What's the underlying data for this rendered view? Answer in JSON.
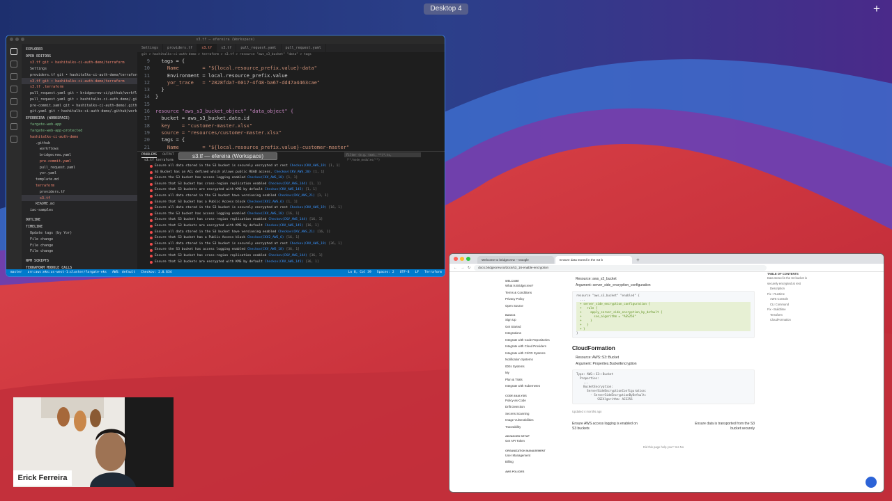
{
  "desktop": {
    "label": "Desktop 4"
  },
  "vscode": {
    "title": "s3.tf — efereira (Workspace)",
    "tabs": [
      "Settings",
      "providers.tf",
      "s3.tf",
      "s3.tf",
      "pull_request.yaml",
      "pull_request.yaml"
    ],
    "breadcrumb": "git > hashitalks-ci-auth-demo > terraform > s3.tf > resource \"aws_s3_bucket\" \"data\" > tags",
    "sidebar": {
      "header": "EXPLORER",
      "open_editors": "OPEN EDITORS",
      "workspace": "EFERREIRA (WORKSPACE)",
      "items": [
        "s3.tf git • hashitalks-ci-auth-demo/terraform",
        "Settings",
        "providers.tf git • hashitalks-ci-auth-demo/terraform",
        "s3.tf git • hashitalks-ci-auth-demo/terraform",
        "s3.tf .terraform",
        "pull_request.yaml git • bridgecrew-ci/github/workflows",
        "pull_request.yaml git • hashitalks-ci-auth-demo/.github",
        "pre-commit.yaml git • hashitalks-ci-auth-demo/.github",
        "git.yaml git • hashitalks-ci-auth-demo/.github/workflows",
        "fargate-web-app",
        "fargate-web-app-protected",
        "hashitalks-ci-auth-demo",
        ".github",
        "workflows",
        "bridgecrew.yaml",
        "pre-commit.yaml",
        "pull_request.yaml",
        "yor.yaml",
        "template.md",
        "terraform",
        "providers.tf",
        "s3.tf",
        "README.md",
        "iac-samples"
      ],
      "outline": "OUTLINE",
      "timeline": "TIMELINE",
      "timeline_items": [
        "Update tags (by Yor)",
        "File change",
        "File change",
        "File change"
      ],
      "npm_scripts": "NPM SCRIPTS",
      "terraform_calls": "TERRAFORM MODULE CALLS"
    },
    "code_lines": [
      {
        "n": "9",
        "t": "  tags = {"
      },
      {
        "n": "10",
        "t": "    Name        = \"${local.resource_prefix.value}-data\""
      },
      {
        "n": "11",
        "t": "    Environment = local.resource_prefix.value"
      },
      {
        "n": "12",
        "t": "    yor_trace   = \"2828fda7-6017-4f48-ba67-dd47a4463cae\""
      },
      {
        "n": "13",
        "t": "  }"
      },
      {
        "n": "14",
        "t": "}"
      },
      {
        "n": "15",
        "t": ""
      },
      {
        "n": "16",
        "t": "resource \"aws_s3_bucket_object\" \"data_object\" {"
      },
      {
        "n": "17",
        "t": "  bucket = aws_s3_bucket.data.id"
      },
      {
        "n": "18",
        "t": "  key    = \"customer-master.xlsx\""
      },
      {
        "n": "19",
        "t": "  source = \"resources/customer-master.xlsx\""
      },
      {
        "n": "20",
        "t": "  tags = {"
      },
      {
        "n": "21",
        "t": "    Name        = \"${local.resource_prefix.value}-customer-master\""
      }
    ],
    "panel": {
      "tabs": [
        "PROBLEMS",
        "OUTPUT",
        "TERMINAL",
        "DEBUG CONSOLE"
      ],
      "filter_placeholder": "Filter (e.g. text, **/*.ts, !**/node_modules/**)",
      "file_header": "s3.tf terraform",
      "problems": [
        {
          "msg": "Ensure all data stored in the S3 bucket is securely encrypted at rest",
          "src": "Checkov(CKV_AWS_19)",
          "pos": "[1, 1]"
        },
        {
          "msg": "S3 Bucket has an ACL defined which allows public READ access.",
          "src": "Checkov(CKV_AWS_20)",
          "pos": "[1, 1]"
        },
        {
          "msg": "Ensure the S3 bucket has access logging enabled",
          "src": "Checkov(CKV_AWS_18)",
          "pos": "[1, 1]"
        },
        {
          "msg": "Ensure that S3 bucket has cross-region replication enabled",
          "src": "Checkov(CKV_AWS_144)",
          "pos": "[1, 1]"
        },
        {
          "msg": "Ensure that S3 buckets are encrypted with KMS by default",
          "src": "Checkov(CKV_AWS_145)",
          "pos": "[1, 1]"
        },
        {
          "msg": "Ensure all data stored in the S3 bucket have versioning enabled",
          "src": "Checkov(CKV_AWS_21)",
          "pos": "[1, 1]"
        },
        {
          "msg": "Ensure that S3 bucket has a Public Access block",
          "src": "Checkov(CKV2_AWS_6)",
          "pos": "[1, 1]"
        },
        {
          "msg": "Ensure all data stored in the S3 bucket is securely encrypted at rest",
          "src": "Checkov(CKV_AWS_19)",
          "pos": "[16, 1]"
        },
        {
          "msg": "Ensure the S3 bucket has access logging enabled",
          "src": "Checkov(CKV_AWS_18)",
          "pos": "[16, 1]"
        },
        {
          "msg": "Ensure that S3 bucket has cross-region replication enabled",
          "src": "Checkov(CKV_AWS_144)",
          "pos": "[16, 1]"
        },
        {
          "msg": "Ensure that S3 buckets are encrypted with KMS by default",
          "src": "Checkov(CKV_AWS_145)",
          "pos": "[16, 1]"
        },
        {
          "msg": "Ensure all data stored in the S3 bucket have versioning enabled",
          "src": "Checkov(CKV_AWS_21)",
          "pos": "[16, 1]"
        },
        {
          "msg": "Ensure that S3 bucket has a Public Access block",
          "src": "Checkov(CKV2_AWS_6)",
          "pos": "[16, 1]"
        },
        {
          "msg": "Ensure all data stored in the S3 bucket is securely encrypted at rest",
          "src": "Checkov(CKV_AWS_19)",
          "pos": "[36, 1]"
        },
        {
          "msg": "Ensure the S3 bucket has access logging enabled",
          "src": "Checkov(CKV_AWS_18)",
          "pos": "[36, 1]"
        },
        {
          "msg": "Ensure that S3 bucket has cross-region replication enabled",
          "src": "Checkov(CKV_AWS_144)",
          "pos": "[36, 1]"
        },
        {
          "msg": "Ensure that S3 buckets are encrypted with KMS by default",
          "src": "Checkov(CKV_AWS_145)",
          "pos": "[36, 1]"
        }
      ]
    },
    "status": {
      "left": [
        "master",
        "arn:aws:eks:us-west-1:cluster/fargate-eks",
        "AWS: default",
        "Checkov: 2.0.634"
      ],
      "right": [
        "Ln 8, Col 39",
        "Spaces: 2",
        "UTF-8",
        "LF",
        "Terraform"
      ]
    }
  },
  "browser": {
    "tabs": [
      "Welcome to bridgecrew – Google",
      "Ensure data stored in the S3 b"
    ],
    "url": "docs.bridgecrew.io/docs/s3_16-enable-encryption",
    "nav": {
      "groups": [
        {
          "title": "WELCOME",
          "items": [
            "What is Bridgecrew?",
            "Terms & Conditions",
            "Privacy Policy",
            "Open Source"
          ]
        },
        {
          "title": "BASICS",
          "items": [
            "Sign Up",
            "Get Started",
            "Integrations",
            "Integrate with Code Repositories",
            "Integrate with Cloud Providers",
            "Integrate with CI/CD Systems",
            "Notification Systems",
            "IDEs Systems",
            "My",
            "Plan & Trials",
            "Integrate with Kubernetes"
          ]
        },
        {
          "title": "CODE ANALYSIS",
          "items": [
            "Policy-as-Code",
            "Drift Detection",
            "Secrets Scanning",
            "Image Vulnerabilities",
            "Traceability"
          ]
        },
        {
          "title": "ADVANCED SETUP",
          "items": [
            "Get API Token"
          ]
        },
        {
          "title": "ORGANIZATION MANAGEMENT",
          "items": [
            "User Management",
            "Billing"
          ]
        },
        {
          "title": "AWS POLICIES",
          "items": []
        }
      ]
    },
    "main": {
      "tf_resource": "Resource: aws_s3_bucket",
      "tf_argument": "Argument: server_side_encryption_configuration",
      "tf_code": [
        "resource \"aws_s3_bucket\" \"enabled\" {",
        "  ...",
        "  + server_side_encryption_configuration {",
        "  +   rule {",
        "  +     apply_server_side_encryption_by_default {",
        "  +       sse_algorithm = \"AES256\"",
        "  +     }",
        "  +   }",
        "  + }",
        "}"
      ],
      "cf_heading": "CloudFormation",
      "cf_resource": "Resource: AWS::S3::Bucket",
      "cf_argument": "Argument: Properties.BucketEncryption",
      "cf_code": [
        "Type: AWS::S3::Bucket",
        "  Properties:",
        "    ...",
        "    BucketEncryption:",
        "      ServerSideEncryptionConfiguration:",
        "        - ServerSideEncryptionByDefault:",
        "            SSEAlgorithm: AES256"
      ],
      "updated": "Updated 4 months ago",
      "prev": "Ensure AWS access logging is enabled on S3 buckets",
      "next": "Ensure data is transported from the S3 bucket securely",
      "feedback": "Did this page help you?   Yes   No"
    },
    "toc": {
      "title": "TABLE OF CONTENTS",
      "items": [
        "Data stored in the S3 bucket is securely encrypted at rest",
        "Description",
        "Fix - Runtime",
        "AWS Console",
        "CLI Command",
        "Fix - Buildtime",
        "Terraform",
        "CloudFormation"
      ]
    }
  },
  "webcam": {
    "name": "Erick Ferreira"
  },
  "colors": {
    "vscode_accent": "#007acc",
    "error": "#f14c4c",
    "wallpaper_red": "#c8323a",
    "wallpaper_blue": "#3a4fb5"
  }
}
